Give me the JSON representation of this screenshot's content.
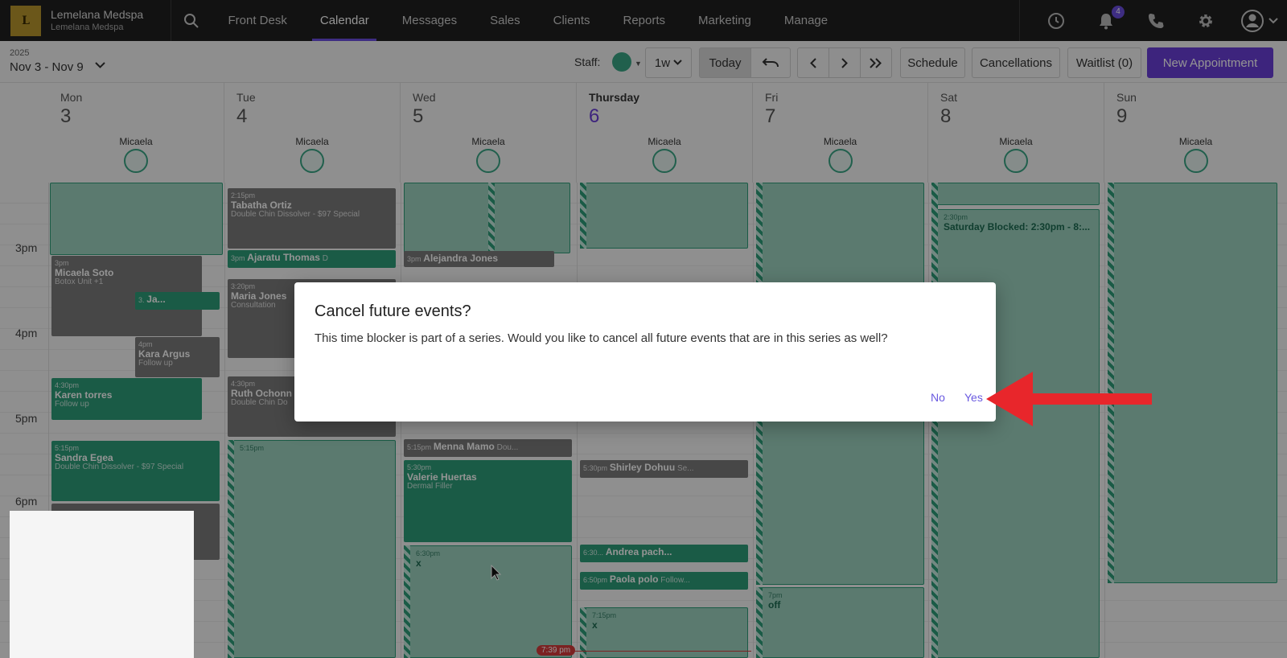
{
  "brand": {
    "name": "Lemelana Medspa",
    "location": "Lemelana Medspa",
    "logo_text": "L"
  },
  "nav": {
    "items": [
      {
        "label": "Front Desk"
      },
      {
        "label": "Calendar",
        "active": true
      },
      {
        "label": "Messages"
      },
      {
        "label": "Sales"
      },
      {
        "label": "Clients"
      },
      {
        "label": "Reports"
      },
      {
        "label": "Marketing"
      },
      {
        "label": "Manage"
      }
    ],
    "notification_count": "4"
  },
  "toolbar": {
    "year": "2025",
    "range": "Nov 3 - Nov 9",
    "staff_label": "Staff:",
    "view": "1w",
    "today": "Today",
    "schedule": "Schedule",
    "cancellations": "Cancellations",
    "waitlist": "Waitlist (0)",
    "new_appointment": "New Appointment"
  },
  "days": [
    {
      "name": "Mon",
      "num": "3",
      "staff": "Micaela"
    },
    {
      "name": "Tue",
      "num": "4",
      "staff": "Micaela"
    },
    {
      "name": "Wed",
      "num": "5",
      "staff": "Micaela"
    },
    {
      "name": "Thursday",
      "num": "6",
      "staff": "Micaela",
      "today": true
    },
    {
      "name": "Fri",
      "num": "7",
      "staff": "Micaela"
    },
    {
      "name": "Sat",
      "num": "8",
      "staff": "Micaela"
    },
    {
      "name": "Sun",
      "num": "9",
      "staff": "Micaela"
    }
  ],
  "times": [
    "3pm",
    "4pm",
    "5pm",
    "6pm"
  ],
  "events": {
    "tabatha": {
      "time": "2:15pm",
      "name": "Tabatha Ortiz",
      "service": "Double Chin Dissolver - $97 Special"
    },
    "ajaratu": {
      "time": "3pm",
      "name": "Ajaratu Thomas",
      "extra": "D"
    },
    "alejandra": {
      "time": "3pm",
      "name": "Alejandra Jones"
    },
    "micaela": {
      "time": "3pm",
      "name": "Micaela Soto",
      "service": "Botox Unit",
      "tag": "+1"
    },
    "ja": {
      "time": "3.",
      "name": "Ja..."
    },
    "maria": {
      "time": "3:20pm",
      "name": "Maria Jones",
      "service": "Consultation"
    },
    "kara": {
      "time": "4pm",
      "name": "Kara Argus",
      "service": "Follow up"
    },
    "karen": {
      "time": "4:30pm",
      "name": "Karen torres",
      "service": "Follow up"
    },
    "ruth": {
      "time": "4:30pm",
      "name": "Ruth Ochonn",
      "service": "Double Chin Do"
    },
    "sandra": {
      "time": "5:15pm",
      "name": "Sandra Egea",
      "service": "Double Chin Dissolver - $97 Special"
    },
    "tue515": {
      "time": "5:15pm"
    },
    "menna": {
      "time": "5:15pm",
      "name": "Menna Mamo",
      "service": "Dou..."
    },
    "valerie": {
      "time": "5:30pm",
      "name": "Valerie Huertas",
      "service": "Dermal Filler"
    },
    "shirley": {
      "time": "5:30pm",
      "name": "Shirley Dohuu",
      "service": "Se..."
    },
    "wed630": {
      "time": "6:30pm",
      "name": "x"
    },
    "andrea": {
      "time": "6:30...",
      "name": "Andrea pach..."
    },
    "paola": {
      "time": "6:50pm",
      "name": "Paola polo",
      "service": "Follow..."
    },
    "thu715": {
      "time": "7:15pm",
      "name": "x"
    },
    "fri7": {
      "time": "7pm",
      "name": "off"
    },
    "saturday": {
      "time": "2:30pm",
      "name": "Saturday Blocked: 2:30pm - 8:..."
    }
  },
  "now_time": "7:39 pm",
  "dialog": {
    "title": "Cancel future events?",
    "body": "This time blocker is part of a series. Would you like to cancel all future events that are in this series as well?",
    "no": "No",
    "yes": "Yes"
  },
  "colors": {
    "accent": "#6a3ed8",
    "event_green": "#2e9e79",
    "arrow": "#e8262b"
  }
}
